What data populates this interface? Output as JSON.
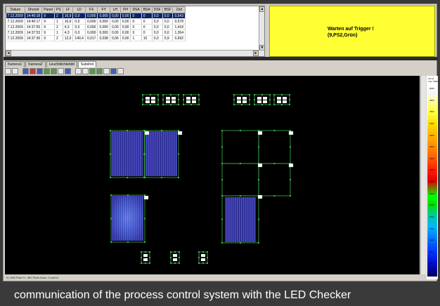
{
  "table": {
    "headers": [
      "Datum",
      "Uhrzeit",
      "Panel",
      "PS",
      "LF",
      "LD",
      "FX",
      "FY",
      "LH",
      "FH",
      "DSA",
      "BSA",
      "DSF",
      "BSF",
      "Zeit"
    ],
    "rows": [
      [
        "7.12.2009",
        "14:40:18",
        "9",
        "2",
        "16,9",
        "0,0",
        "0,000",
        "0,000",
        "0,00",
        "0,00",
        "0",
        "0",
        "0,0",
        "0,0",
        "0,543"
      ],
      [
        "7.12.2009",
        "14:40:17",
        "9",
        "1",
        "16,9",
        "0,0",
        "0,000",
        "0,000",
        "0,00",
        "0,00",
        "0",
        "0",
        "0,0",
        "0,0",
        "0,578"
      ],
      [
        "7.12.2009",
        "14:37:55",
        "9",
        "2",
        "4,3",
        "0,0",
        "0,000",
        "0,000",
        "0,00",
        "0,00",
        "0",
        "0",
        "0,0",
        "0,0",
        "1,418"
      ],
      [
        "7.12.2009",
        "14:37:53",
        "9",
        "1",
        "4,3",
        "0,0",
        "0,000",
        "0,000",
        "0,00",
        "0,00",
        "0",
        "0",
        "0,0",
        "0,0",
        "1,264"
      ],
      [
        "7.12.2009",
        "14:37:36",
        "9",
        "2",
        "12,0",
        "140,4",
        "0,017",
        "0,038",
        "0,06",
        "0,00",
        "1",
        "10",
        "0,0",
        "0,9",
        "0,692"
      ]
    ]
  },
  "status": {
    "line1": "Warten auf Trigger !",
    "line2": "(9,PS2,Grün)"
  },
  "tabs": [
    "Kamera1",
    "Kamera2",
    "Leuchtdichtebild",
    "Subshot"
  ],
  "active_tab_index": 3,
  "colorbar": {
    "header": "cd/m2 max. 5000",
    "ticks": [
      "5000",
      "4800",
      "4500",
      "4200",
      "3900",
      "3600",
      "3300",
      "3000",
      "2700",
      "2400",
      "2100",
      "1800",
      "1500",
      "1200",
      "900",
      "600",
      "300"
    ]
  },
  "statusbar": "X= 659 Pixel Y= 361 Pixel Grau= 0 cd/m2",
  "caption": "communication of the process control system with the LED Checker",
  "colors": {
    "status_bg": "#ffff33",
    "selected_row": "#0a246a",
    "roi_green": "#3cb44b",
    "led_blue": "#3a3aa8"
  }
}
